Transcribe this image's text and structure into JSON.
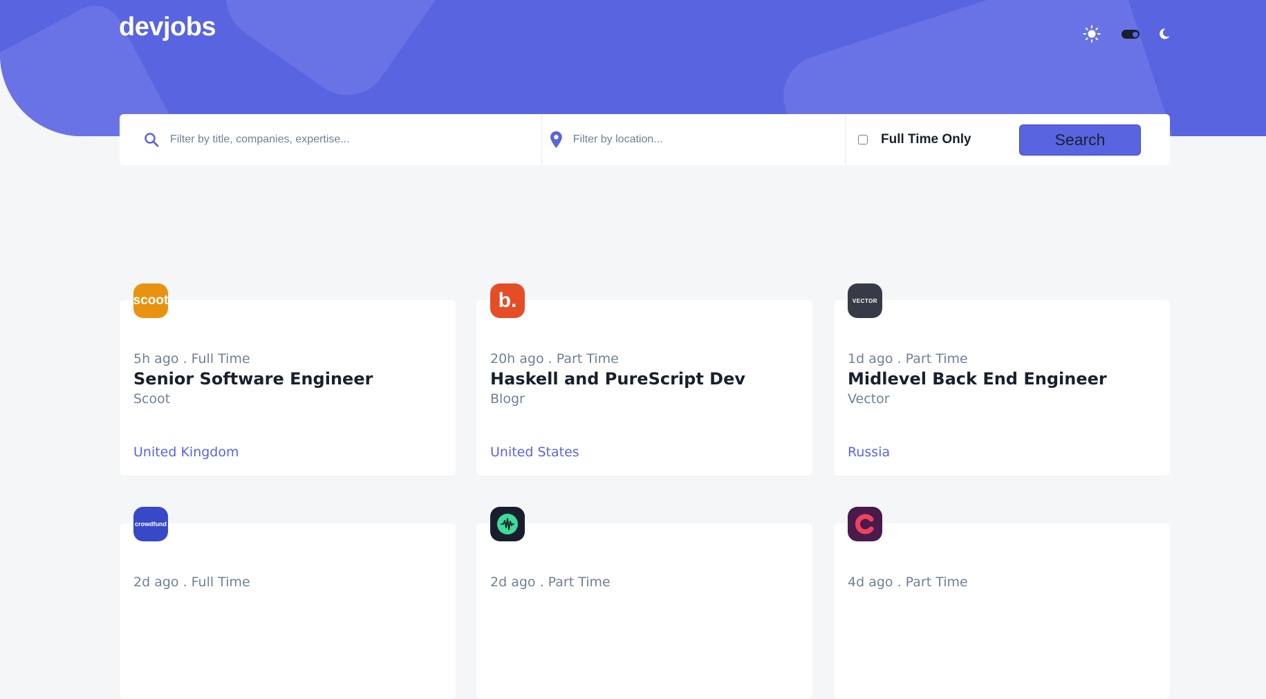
{
  "header": {
    "logo": "devjobs",
    "colors": {
      "brand": "#5964E0",
      "shape": "#6A73E5"
    },
    "theme_toggle": {
      "sun_icon": "sun-icon",
      "moon_icon": "moon-icon",
      "state": "dark-off"
    }
  },
  "search": {
    "title_placeholder": "Filter by title, companies, expertise...",
    "location_placeholder": "Filter by location...",
    "fulltime_label": "Full Time Only",
    "fulltime_checked": false,
    "button_label": "Search",
    "icons": {
      "title": "search-icon",
      "location": "location-pin-icon"
    }
  },
  "jobs": [
    {
      "posted": "5h ago",
      "contract": "Full Time",
      "position": "Senior Software Engineer",
      "company": "Scoot",
      "location": "United Kingdom",
      "logo_text": "scoot",
      "logo_bg": "#E99210"
    },
    {
      "posted": "20h ago",
      "contract": "Part Time",
      "position": "Haskell and PureScript Dev",
      "company": "Blogr",
      "location": "United States",
      "logo_text": "b.",
      "logo_bg": "#E54D26"
    },
    {
      "posted": "1d ago",
      "contract": "Part Time",
      "position": "Midlevel Back End Engineer",
      "company": "Vector",
      "location": "Russia",
      "logo_text": "VECTOR",
      "logo_bg": "#373B47"
    },
    {
      "posted": "2d ago",
      "contract": "Full Time",
      "logo_text": "crowdfund",
      "logo_bg": "#3749C7"
    },
    {
      "posted": "2d ago",
      "contract": "Part Time",
      "logo_text": "",
      "logo_bg": "#1A1E2C"
    },
    {
      "posted": "4d ago",
      "contract": "Part Time",
      "logo_text": "",
      "logo_bg": "#4A1A4C"
    }
  ]
}
